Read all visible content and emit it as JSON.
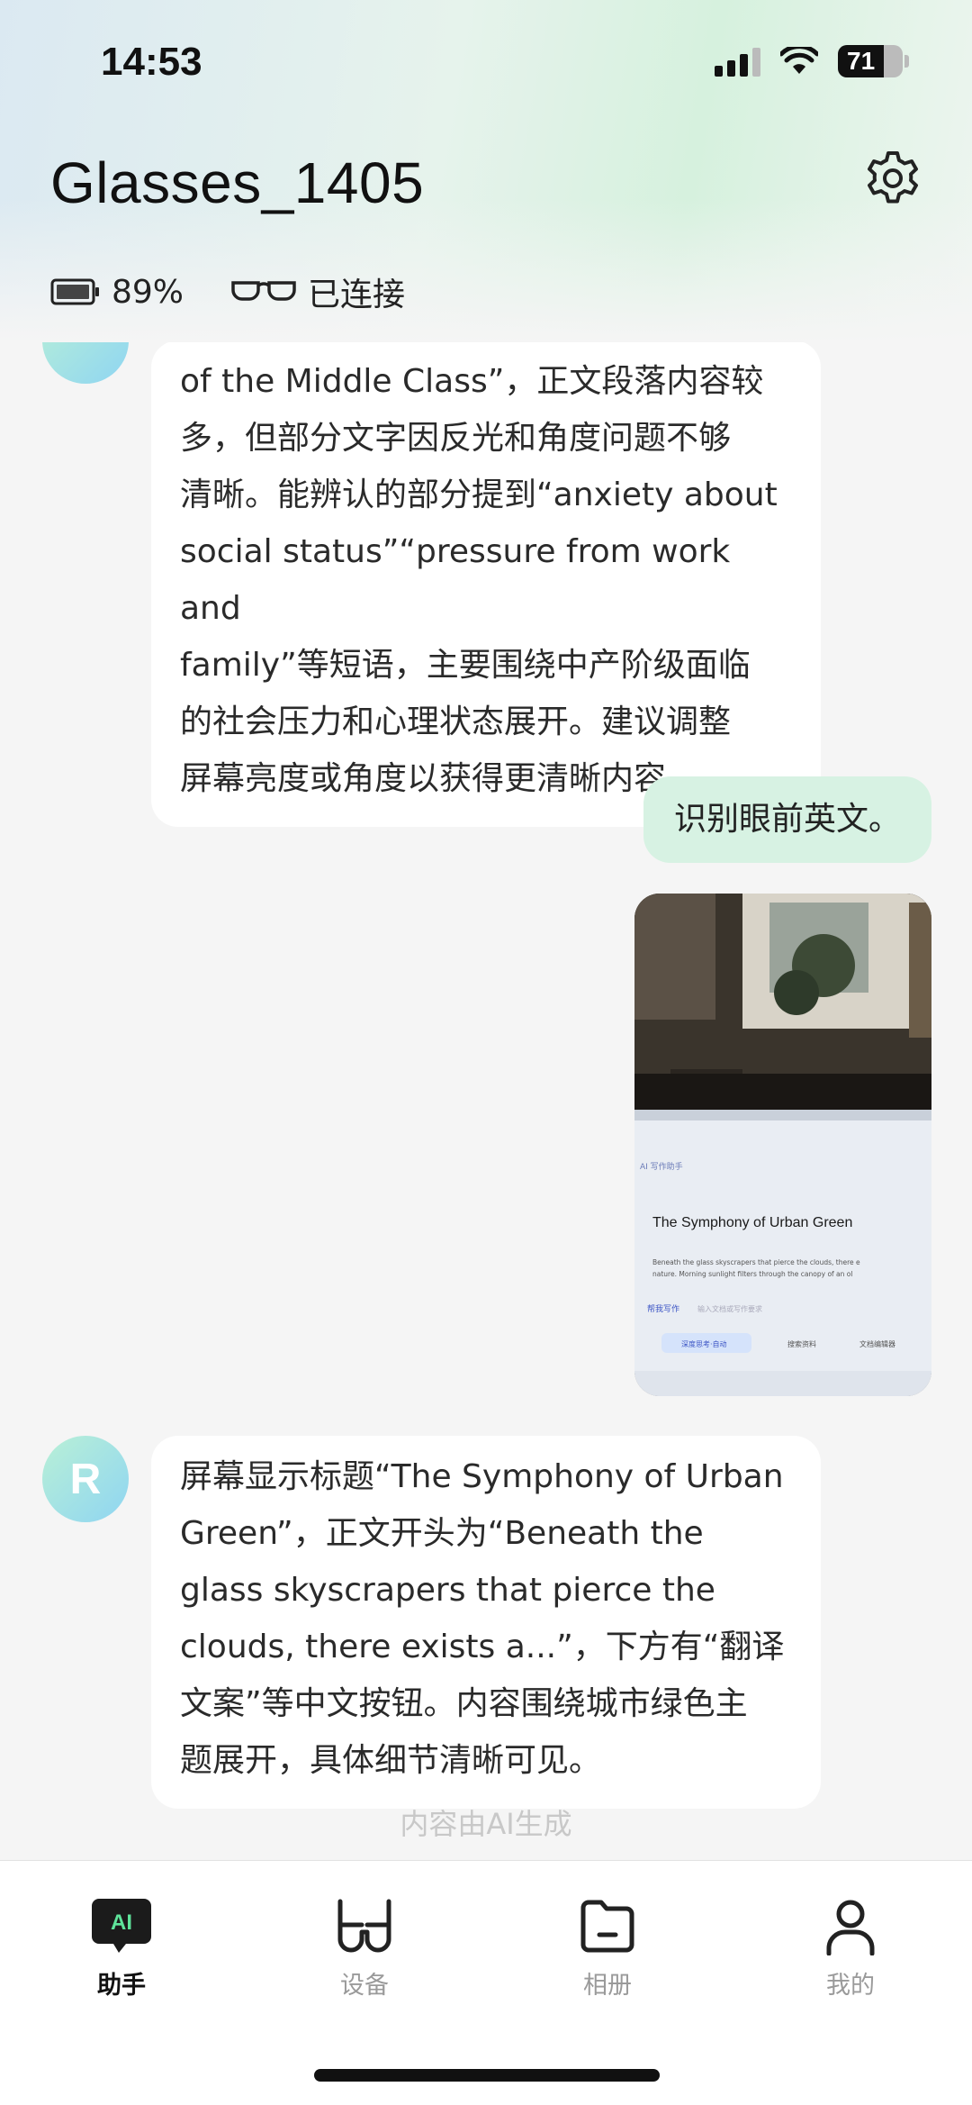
{
  "status_bar": {
    "time": "14:53",
    "battery": "71",
    "battery_level": 0.71
  },
  "header": {
    "title": "Glasses_1405"
  },
  "device": {
    "battery_percent": "89%",
    "connection": "已连接"
  },
  "chat": {
    "messages": [
      {
        "role": "assistant",
        "lines": [
          "of the Middle Class”，正文段落内容较",
          "多，但部分文字因反光和角度问题不够",
          "清晰。能辨认的部分提到“anxiety about",
          "social status”“pressure from work and",
          "family”等短语，主要围绕中产阶级面临",
          "的社会压力和心理状态展开。建议调整",
          "屏幕亮度或角度以获得更清晰内容。"
        ]
      },
      {
        "role": "user",
        "text": "识别眼前英文。"
      },
      {
        "role": "user_image",
        "photo": {
          "lang_tag": "AI 写作助手",
          "doc_title": "The Symphony of Urban Green",
          "body_line1": "Beneath the glass skyscrapers that pierce the clouds, there e",
          "body_line2": "nature. Morning sunlight filters through the canopy of an ol",
          "help_write": "帮我写作",
          "placeholder": "输入文档或写作要求",
          "chip1": "深度思考·自动",
          "chip2": "搜索资料",
          "chip3": "文档编辑器"
        }
      },
      {
        "role": "assistant",
        "avatar_letter": "R",
        "lines": [
          "屏幕显示标题“The Symphony of Urban",
          "Green”，正文开头为“Beneath the",
          "glass skyscrapers that pierce the",
          "clouds, there exists a...”，下方有“翻译",
          "文案”等中文按钮。内容围绕城市绿色主",
          "题展开，具体细节清晰可见。"
        ]
      }
    ],
    "footer_note": "内容由AI生成"
  },
  "tabbar": {
    "items": [
      {
        "label": "助手",
        "icon": "ai-assistant-icon",
        "badge": "AI",
        "active": true
      },
      {
        "label": "设备",
        "icon": "glasses-device-icon",
        "active": false
      },
      {
        "label": "相册",
        "icon": "album-folder-icon",
        "active": false
      },
      {
        "label": "我的",
        "icon": "profile-person-icon",
        "active": false
      }
    ]
  },
  "colors": {
    "accent_green": "#d7f2e3",
    "avatar_gradient_start": "#b9f0d6",
    "avatar_gradient_end": "#8fd5f2",
    "ai_badge_text": "#5ee39a"
  }
}
